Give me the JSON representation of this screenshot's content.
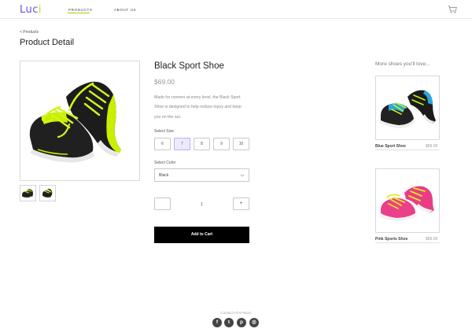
{
  "header": {
    "logo": "Luci",
    "nav": {
      "products": "PRODUCTS",
      "about": "ABOUT US"
    }
  },
  "breadcrumb": "< Products",
  "page_title": "Product Detail",
  "product": {
    "name": "Black Sport Shoe",
    "price": "$69.00",
    "description": "Made for runners at every level, the Black Sport Shoe is designed to help reduce injury and keep you on the run.",
    "size_label": "Select Size",
    "sizes": [
      "6",
      "7",
      "8",
      "9",
      "10"
    ],
    "selected_size": "7",
    "color_label": "Select Color",
    "color_value": "Black",
    "quantity": "1",
    "qty_plus": "+",
    "add_to_cart": "Add to Cart"
  },
  "recommendations": {
    "title": "More shoes you'll love...",
    "items": [
      {
        "name": "Blue Sport Shoe",
        "price": "$69.00"
      },
      {
        "name": "Pink Sports Shoe",
        "price": "$69.00"
      }
    ]
  },
  "footer": {
    "label": "Contact Information",
    "social": {
      "facebook": "f",
      "twitter": "t",
      "pinterest": "p",
      "instagram": "◎"
    }
  },
  "colors": {
    "accent_purple": "#6b4fd8",
    "accent_lime": "#a4d100",
    "button_black": "#000000",
    "selected_size_bg": "#ecebfd"
  }
}
